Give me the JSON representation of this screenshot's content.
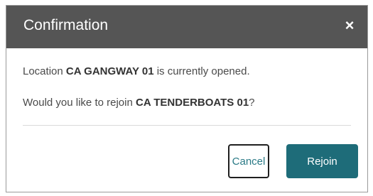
{
  "dialog": {
    "title": "Confirmation",
    "close_glyph": "×",
    "message_line1": {
      "prefix": "Location ",
      "location": "CA GANGWAY 01",
      "suffix": " is currently opened."
    },
    "message_line2": {
      "prefix": "Would you like to rejoin ",
      "location": "CA TENDERBOATS 01",
      "suffix": "?"
    },
    "buttons": {
      "cancel_label": "Cancel",
      "rejoin_label": "Rejoin"
    }
  },
  "colors": {
    "header_bg": "#555555",
    "primary_button": "#1e6c79",
    "cancel_text": "#2a7a86"
  }
}
